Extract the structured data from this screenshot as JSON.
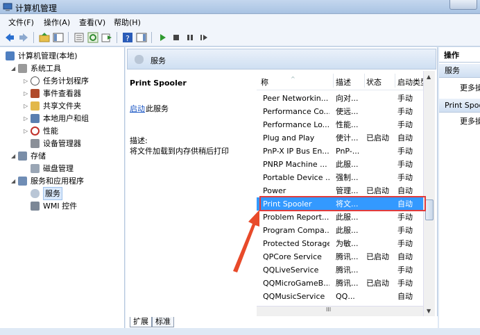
{
  "window": {
    "title": "计算机管理"
  },
  "menu": [
    "文件(F)",
    "操作(A)",
    "查看(V)",
    "帮助(H)"
  ],
  "toolbar": {
    "icons": [
      "back-icon",
      "forward-icon",
      "up-folder-icon",
      "show-hide-tree-icon",
      "properties-icon",
      "refresh-icon",
      "export-icon",
      "help-icon",
      "show-hide-action-icon",
      "start-icon",
      "stop-icon",
      "pause-icon",
      "restart-icon"
    ]
  },
  "tree": {
    "root": "计算机管理(本地)",
    "system_tools": "系统工具",
    "task_scheduler": "任务计划程序",
    "event_viewer": "事件查看器",
    "shared_folders": "共享文件夹",
    "local_users": "本地用户和组",
    "performance": "性能",
    "device_manager": "设备管理器",
    "storage": "存储",
    "disk_management": "磁盘管理",
    "services_apps": "服务和应用程序",
    "services": "服务",
    "wmi": "WMI 控件"
  },
  "center": {
    "header_title": "服务",
    "selected_service": "Print Spooler",
    "start_link": "启动",
    "start_rest": "此服务",
    "desc_label": "描述:",
    "desc_text": "将文件加载到内存供稍后打印"
  },
  "list": {
    "columns": {
      "name": "称",
      "desc": "描述",
      "status": "状态",
      "start": "启动类型"
    },
    "rows": [
      {
        "name": "Peer Networkin...",
        "desc": "向对...",
        "status": "",
        "start": "手动"
      },
      {
        "name": "Performance Co...",
        "desc": "使远...",
        "status": "",
        "start": "手动"
      },
      {
        "name": "Performance Lo...",
        "desc": "性能...",
        "status": "",
        "start": "手动"
      },
      {
        "name": "Plug and Play",
        "desc": "使计...",
        "status": "已启动",
        "start": "自动"
      },
      {
        "name": "PnP-X IP Bus En...",
        "desc": "PnP-...",
        "status": "",
        "start": "手动"
      },
      {
        "name": "PNRP Machine ...",
        "desc": "此服...",
        "status": "",
        "start": "手动"
      },
      {
        "name": "Portable Device ...",
        "desc": "强制...",
        "status": "",
        "start": "手动"
      },
      {
        "name": "Power",
        "desc": "管理...",
        "status": "已启动",
        "start": "自动"
      },
      {
        "name": "Print Spooler",
        "desc": "将文...",
        "status": "",
        "start": "自动"
      },
      {
        "name": "Problem Report...",
        "desc": "此服...",
        "status": "",
        "start": "手动"
      },
      {
        "name": "Program Compa...",
        "desc": "此服...",
        "status": "",
        "start": "手动"
      },
      {
        "name": "Protected Storage",
        "desc": "为敏...",
        "status": "",
        "start": "手动"
      },
      {
        "name": "QPCore Service",
        "desc": "腾讯...",
        "status": "已启动",
        "start": "自动"
      },
      {
        "name": "QQLiveService",
        "desc": "腾讯...",
        "status": "",
        "start": "手动"
      },
      {
        "name": "QQMicroGameB...",
        "desc": "腾讯...",
        "status": "已启动",
        "start": "手动"
      },
      {
        "name": "QQMusicService",
        "desc": "QQ...",
        "status": "",
        "start": "自动"
      }
    ],
    "hscroll_grip": "III"
  },
  "tabs": [
    "扩展",
    "标准"
  ],
  "actions": {
    "title": "操作",
    "group1": "服务",
    "group1_more": "更多操",
    "group2": "Print Spoo",
    "group2_more": "更多操"
  },
  "colors": {
    "selection": "#3399ff",
    "highlight_box": "#e23b3b",
    "link": "#1a56c4"
  }
}
